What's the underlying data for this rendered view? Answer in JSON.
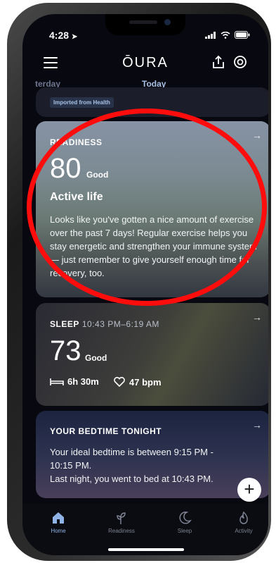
{
  "status": {
    "time": "4:28"
  },
  "header": {
    "logo": "ŌURA"
  },
  "tabs": {
    "yesterday": "terday",
    "today": "Today"
  },
  "previous_card": {
    "badge": "Imported from Health"
  },
  "readiness": {
    "label": "READINESS",
    "score": "80",
    "rating": "Good",
    "title": "Active life",
    "text": "Looks like you've gotten a nice amount of exercise over the past 7 days! Regular exercise helps you stay energetic and strengthen your immune system — just remember to give yourself enough time for recovery, too."
  },
  "sleep": {
    "label": "SLEEP",
    "time_range": "10:43 PM–6:19 AM",
    "score": "73",
    "rating": "Good",
    "duration": "6h 30m",
    "heart_rate": "47 bpm"
  },
  "bedtime": {
    "label": "YOUR BEDTIME TONIGHT",
    "line1": "Your ideal bedtime is between 9:15 PM - 10:15 PM.",
    "line2": "Last night, you went to bed at 10:43 PM."
  },
  "nav": {
    "home": "Home",
    "readiness": "Readiness",
    "sleep": "Sleep",
    "activity": "Activity"
  },
  "colors": {
    "accent": "#a7c1e6",
    "annotation": "#ff0d0d"
  }
}
